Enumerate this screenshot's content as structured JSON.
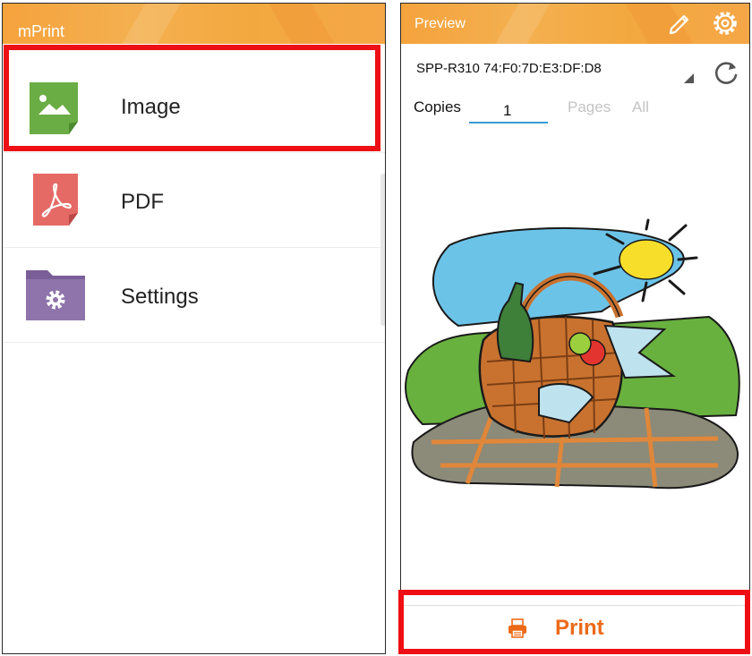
{
  "left_screen": {
    "app_title": "mPrint",
    "menu": [
      {
        "label": "Image",
        "icon": "image-icon",
        "color": "#6aad44"
      },
      {
        "label": "PDF",
        "icon": "pdf-icon",
        "color": "#e56a66"
      },
      {
        "label": "Settings",
        "icon": "settings-folder-icon",
        "color": "#8f74ab"
      }
    ]
  },
  "right_screen": {
    "title": "Preview",
    "header_icons": [
      "pencil-icon",
      "gear-icon"
    ],
    "printer": {
      "name": "SPP-R310 74:F0:7D:E3:DF:D8",
      "refresh_icon": "refresh-icon"
    },
    "copies_label": "Copies",
    "copies_value": "1",
    "pages_label": "Pages",
    "pages_value": "All",
    "preview_image": "picnic-basket-clipart",
    "print_button": {
      "label": "Print",
      "icon": "printer-icon"
    }
  },
  "colors": {
    "accent": "#f5a33d",
    "print_text": "#ec6a18",
    "highlight": "#ee0f14",
    "input_underline": "#3a9bd7"
  }
}
